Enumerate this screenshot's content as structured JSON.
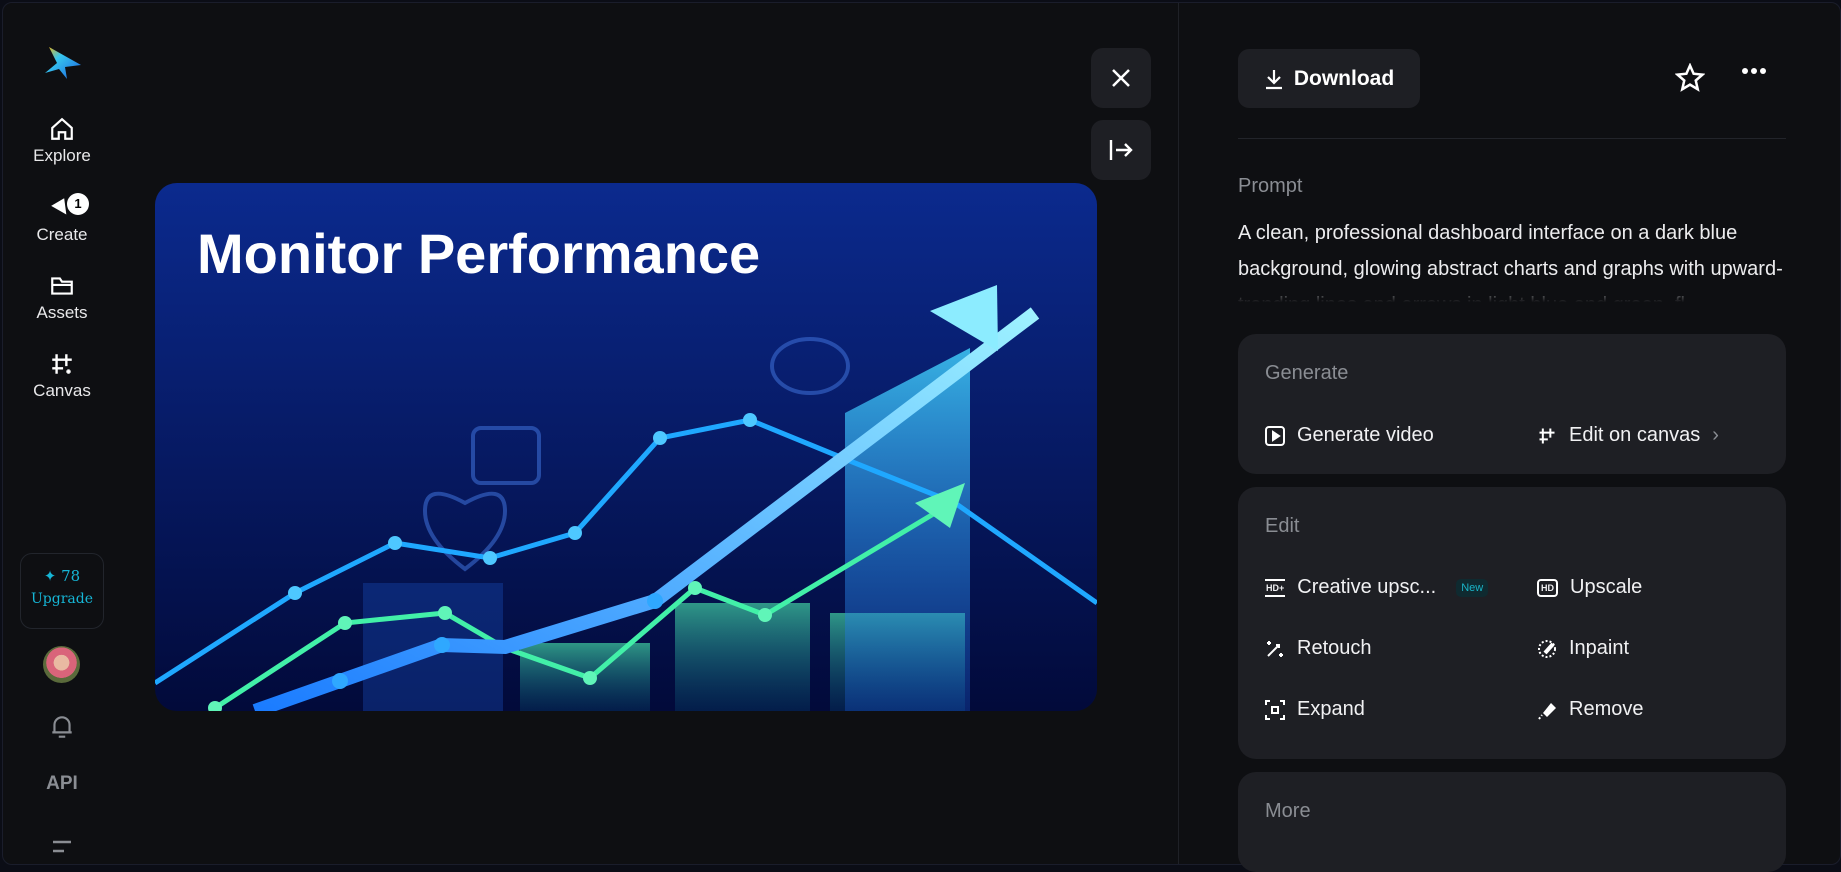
{
  "sidebar": {
    "nav": [
      {
        "label": "Explore",
        "icon": "home-icon"
      },
      {
        "label": "Create",
        "icon": "create-icon",
        "badge": "1"
      },
      {
        "label": "Assets",
        "icon": "folder-icon"
      },
      {
        "label": "Canvas",
        "icon": "canvas-icon"
      }
    ],
    "credits": "78",
    "upgrade": "Upgrade",
    "api": "API"
  },
  "preview": {
    "image_title": "Monitor Performance"
  },
  "toolbar": {
    "download": "Download"
  },
  "prompt": {
    "label": "Prompt",
    "text": "A clean, professional dashboard interface on a dark blue background, glowing abstract charts and graphs with upward-trending lines and arrows in light blue and green, fl"
  },
  "generate": {
    "title": "Generate",
    "items": [
      "Generate video",
      "Edit on canvas"
    ]
  },
  "edit": {
    "title": "Edit",
    "items": [
      "Creative upsc...",
      "Upscale",
      "Retouch",
      "Inpaint",
      "Expand",
      "Remove"
    ],
    "new_badge": "New"
  },
  "more": {
    "title": "More"
  },
  "colors": {
    "accent": "#16b6d6",
    "card": "#1e1f24",
    "bg": "#0e0f12"
  }
}
